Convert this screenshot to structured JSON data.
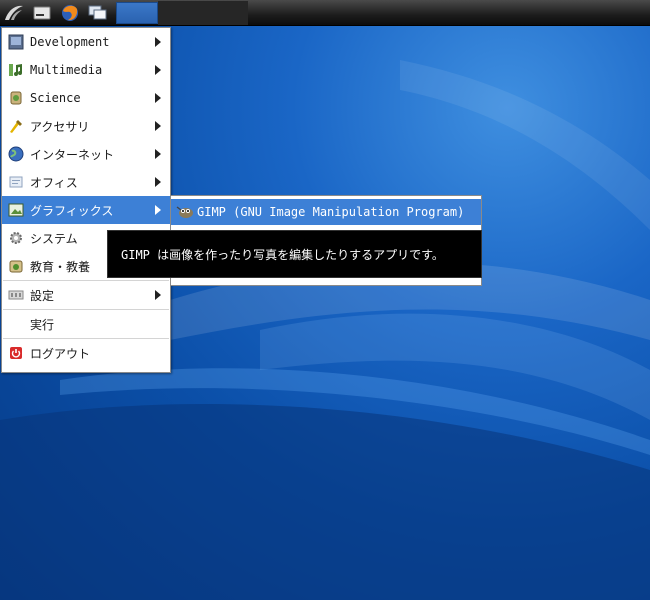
{
  "panel": {
    "icons": [
      "lxde-logo-icon",
      "terminal-icon",
      "firefox-icon",
      "windows-icon"
    ]
  },
  "menu": {
    "items": [
      {
        "label": "Development",
        "icon": "development-icon",
        "submenu": true
      },
      {
        "label": "Multimedia",
        "icon": "multimedia-icon",
        "submenu": true
      },
      {
        "label": "Science",
        "icon": "science-icon",
        "submenu": true
      },
      {
        "label": "アクセサリ",
        "icon": "accessories-icon",
        "submenu": true
      },
      {
        "label": "インターネット",
        "icon": "internet-icon",
        "submenu": true
      },
      {
        "label": "オフィス",
        "icon": "office-icon",
        "submenu": true
      },
      {
        "label": "グラフィックス",
        "icon": "graphics-icon",
        "submenu": true,
        "active": true
      },
      {
        "label": "システム",
        "icon": "system-icon",
        "submenu": true
      },
      {
        "label": "教育・教養",
        "icon": "education-icon",
        "submenu": true
      },
      {
        "label": "設定",
        "icon": "settings-icon",
        "submenu": true
      },
      {
        "label": "実行",
        "icon": "",
        "submenu": false
      },
      {
        "label": "ログアウト",
        "icon": "logout-icon",
        "submenu": false
      }
    ]
  },
  "submenu": {
    "item_label": "GIMP (GNU Image Manipulation Program)",
    "item_icon": "gimp-icon"
  },
  "tooltip": {
    "text": "GIMP は画像を作ったり写真を編集したりするアプリです。"
  },
  "colors": {
    "highlight": "#3d80d6",
    "desktop": "#0b4fa8"
  }
}
